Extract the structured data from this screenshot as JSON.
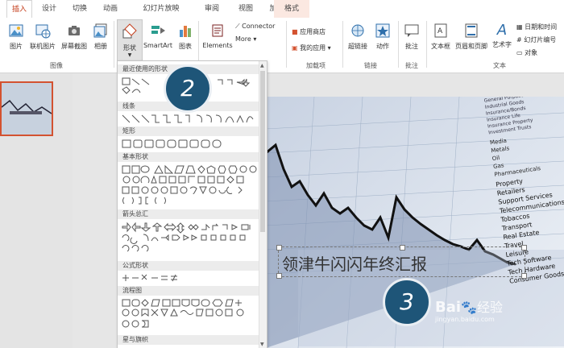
{
  "tabs": [
    {
      "label": "插入",
      "active": true
    },
    {
      "label": "设计"
    },
    {
      "label": "切换"
    },
    {
      "label": "动画"
    },
    {
      "label": "幻灯片放映"
    },
    {
      "label": "审阅"
    },
    {
      "label": "视图"
    },
    {
      "label": "加载项"
    },
    {
      "label": "格式",
      "contextual": true
    }
  ],
  "ribbon": {
    "image_group": {
      "label": "图像",
      "picture": "图片",
      "online_picture": "联机图片",
      "screenshot": "屏幕截图",
      "album": "相册"
    },
    "illustrations": {
      "shapes": "形状",
      "smartart": "SmartArt",
      "chart": "图表"
    },
    "elements": {
      "label": "Elements",
      "connector": "Connector",
      "more": "More"
    },
    "addins": {
      "label": "加载项",
      "store": "应用商店",
      "my_apps": "我的应用"
    },
    "links": {
      "label": "链接",
      "hyperlink": "超链接",
      "action": "动作"
    },
    "comments": {
      "label": "批注",
      "comment": "批注"
    },
    "text": {
      "label": "文本",
      "textbox": "文本框",
      "header_footer": "页眉和页脚",
      "wordart": "艺术字",
      "datetime": "日期和时间",
      "slide_number": "幻灯片编号",
      "object": "对象"
    }
  },
  "gallery": {
    "sections": [
      "最近使用的形状",
      "线条",
      "矩形",
      "基本形状",
      "箭头总汇",
      "公式形状",
      "流程图",
      "星与旗帜"
    ]
  },
  "slide": {
    "title": "领津牛闪闪年终汇报",
    "list": [
      "General Purpose",
      "Industrial Goods",
      "Insurance/Bonds",
      "Insurance Life",
      "Insurance Property",
      "Investment Trusts",
      "Media",
      "Metals",
      "Oil",
      "Gas",
      "Pharmaceuticals",
      "Property",
      "Retailers",
      "Support Services",
      "Telecommunications",
      "Tobaccos",
      "Transport",
      "Real Estate",
      "Travel",
      "Leisure",
      "Tech Software",
      "Tech Hardware",
      "Consumer Goods"
    ]
  },
  "callouts": {
    "step_a": "2",
    "step_b": "3"
  },
  "watermark": {
    "brand": "Bai",
    "brand_suffix": "经验",
    "url": "jingyan.baidu.com"
  },
  "colors": {
    "accent": "#c43e1c",
    "callout": "#1e5578",
    "thumb_border": "#d35230"
  }
}
